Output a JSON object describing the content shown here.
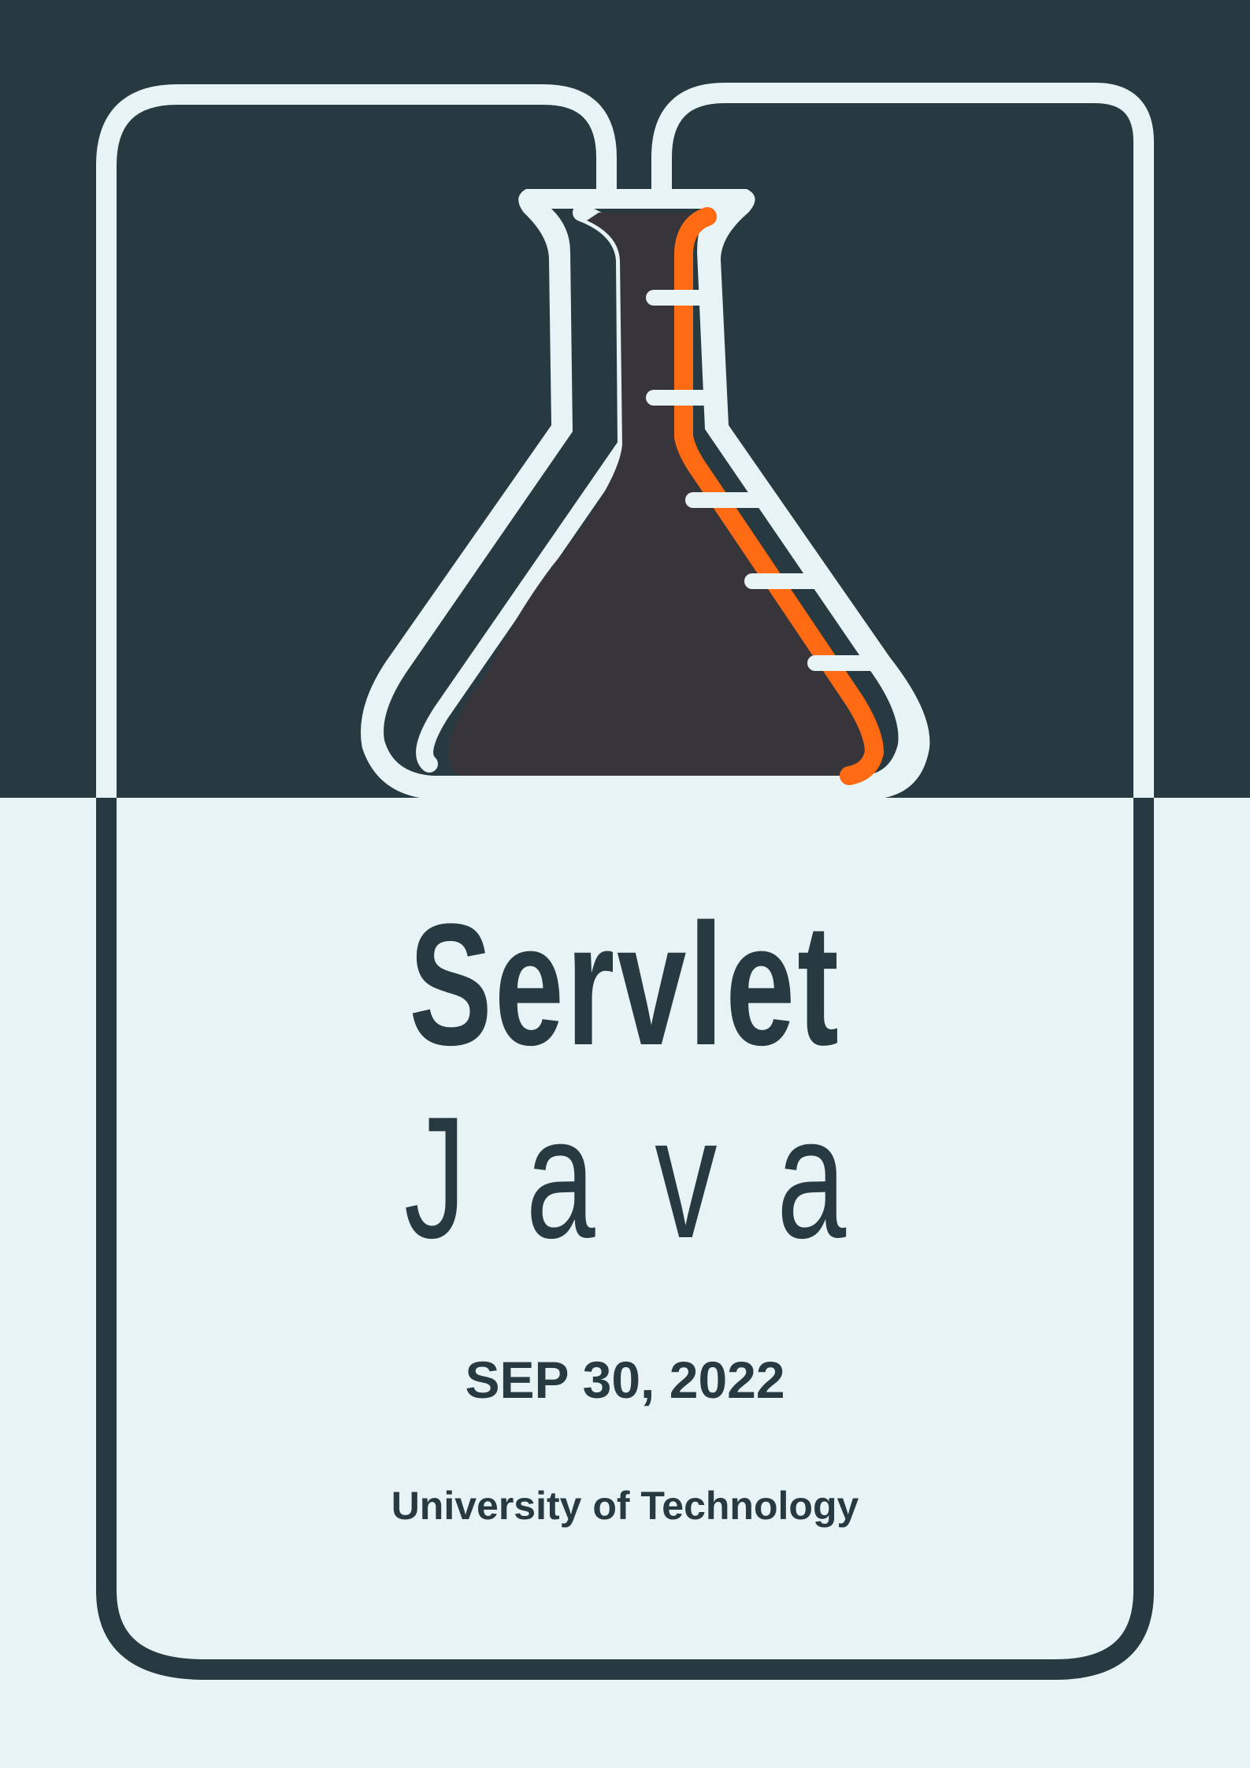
{
  "cover": {
    "title_line1": "Servlet",
    "title_line2": "Java",
    "date": "SEP 30, 2022",
    "organization": "University of Technology"
  },
  "colors": {
    "dark": "#283a41",
    "light": "#e7f3f4",
    "flask_fill": "#38353a",
    "accent": "#ff6a13"
  },
  "icons": [
    "erlenmeyer-flask-icon"
  ]
}
